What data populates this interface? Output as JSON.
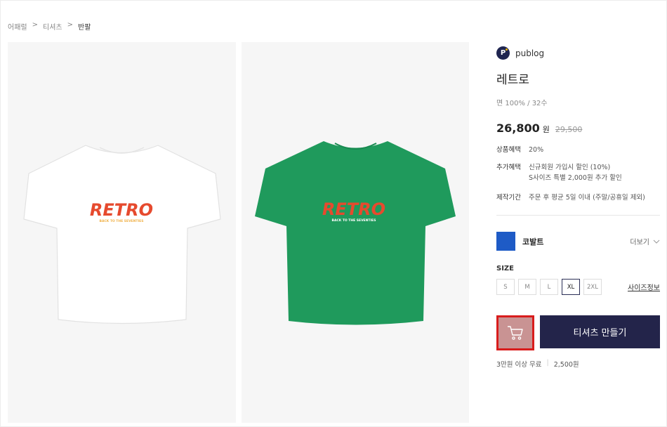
{
  "breadcrumb": [
    "어패럴",
    ">",
    "티셔츠",
    ">",
    "반팔"
  ],
  "product_images": [
    {
      "shirt_color": "#ffffff",
      "print_text": "RETRO",
      "print_subtext": "BACK TO THE SEVENTIES"
    },
    {
      "shirt_color": "#1f9a5c",
      "print_text": "RETRO",
      "print_subtext": "BACK TO THE SEVENTIES"
    }
  ],
  "brand": {
    "logo_letter": "P",
    "name": "publog"
  },
  "product": {
    "title": "레트로",
    "material": "면 100% / 32수",
    "price": "26,800",
    "currency": "원",
    "original_price": "29,500"
  },
  "benefits": [
    {
      "label": "상품혜택",
      "lines": [
        "20%"
      ]
    },
    {
      "label": "추가혜택",
      "lines": [
        "신규회원 가입시 할인 (10%)",
        "S사이즈 특별 2,000원 추가 할인"
      ]
    },
    {
      "label": "제작기간",
      "lines": [
        "주문 후 평균 5일 이내 (주말/공휴일 제외)"
      ]
    }
  ],
  "color": {
    "name": "코발트",
    "hex": "#1e5bc6",
    "more_label": "더보기"
  },
  "size": {
    "heading": "SIZE",
    "options": [
      "S",
      "M",
      "L",
      "XL",
      "2XL"
    ],
    "selected": "XL",
    "guide_label": "사이즈정보"
  },
  "actions": {
    "cart_icon": "cart-icon",
    "make_label": "티셔츠 만들기"
  },
  "shipping": {
    "free_text": "3만원 이상 무료",
    "separator": "|",
    "fee": "2,500원"
  }
}
